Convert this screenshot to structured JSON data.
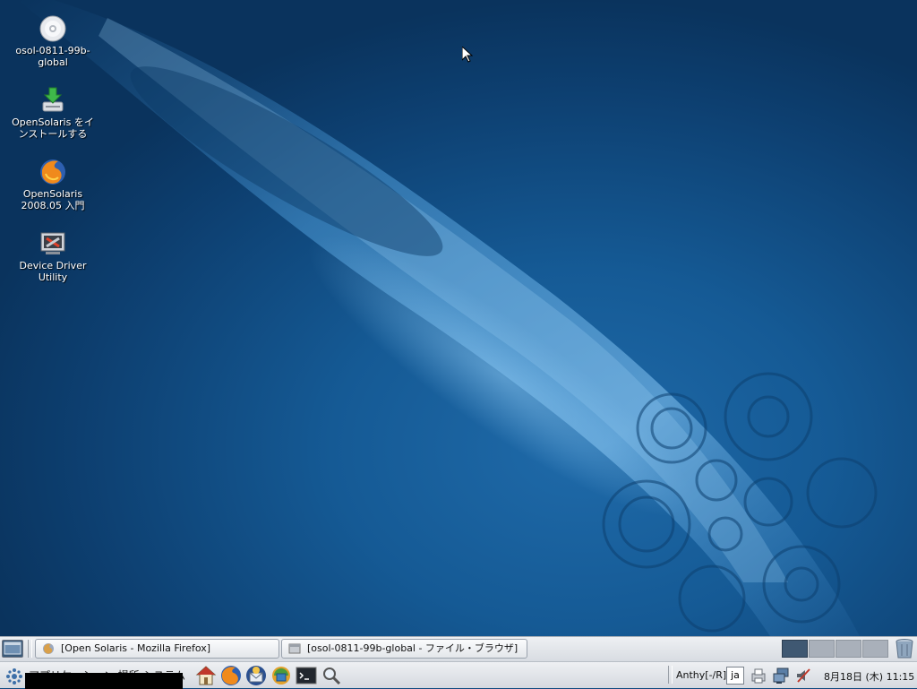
{
  "desktop": {
    "icons": [
      {
        "label": "osol-0811-99b-\nglobal",
        "icon": "cd-disc-icon"
      },
      {
        "label": "OpenSolaris をイ\nンストールする",
        "icon": "install-download-icon"
      },
      {
        "label": "OpenSolaris\n2008.05 入門",
        "icon": "firefox-icon"
      },
      {
        "label": "Device Driver\nUtility",
        "icon": "device-driver-tool-icon"
      }
    ]
  },
  "taskbar": {
    "tasks": [
      {
        "label": "[Open Solaris - Mozilla Firefox]",
        "icon": "firefox-icon"
      },
      {
        "label": "[osol-0811-99b-global - ファイル・ブラウザ]",
        "icon": "file-browser-icon"
      }
    ],
    "workspaces": {
      "count": 4,
      "active": 1
    }
  },
  "menubar": {
    "menus_text": "アプリケーション  場所  システム"
  },
  "tray": {
    "ime_status": "Anthy[-/R]",
    "ime_lang": "ja",
    "clock": "8月18日 (木) 11:15"
  },
  "colors": {
    "panel": "#e4e7eb",
    "desktop_bg": "#0f4a7f",
    "active_workspace": "#3f5872"
  }
}
